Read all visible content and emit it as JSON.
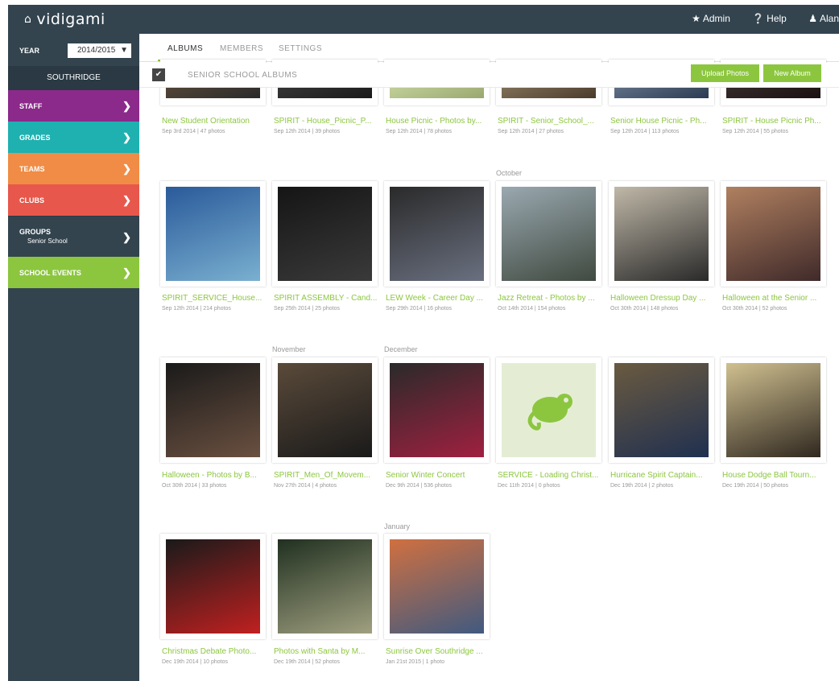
{
  "header": {
    "logo": "vidigami",
    "links": [
      {
        "icon": "star-icon",
        "label": "Admin"
      },
      {
        "icon": "help-icon",
        "label": "Help"
      },
      {
        "icon": "user-icon",
        "label": "Alan"
      }
    ]
  },
  "sidebar": {
    "year_label": "YEAR",
    "year_value": "2014/2015",
    "school": "SOUTHRIDGE",
    "items": [
      {
        "label": "STAFF",
        "color": "#8b2a8a"
      },
      {
        "label": "GRADES",
        "color": "#1eb1b0"
      },
      {
        "label": "TEAMS",
        "color": "#f08c45"
      },
      {
        "label": "CLUBS",
        "color": "#e8574b"
      },
      {
        "label": "GROUPS",
        "sub": "Senior School",
        "color": "#33444f"
      },
      {
        "label": "SCHOOL EVENTS",
        "color": "#8cc63f"
      }
    ]
  },
  "tabs": [
    "ALBUMS",
    "MEMBERS",
    "SETTINGS"
  ],
  "album_bar": {
    "title": "SENIOR SCHOOL ALBUMS",
    "upload_label": "Upload Photos",
    "new_album_label": "New Album"
  },
  "months": [
    "October",
    "November",
    "December",
    "January"
  ],
  "albums": [
    {
      "title": "New Student Orientation",
      "meta": "Sep 3rd 2014 | 47 photos"
    },
    {
      "title": "SPIRIT - House_Picnic_P...",
      "meta": "Sep 12th 2014 | 39 photos"
    },
    {
      "title": "House Picnic - Photos by...",
      "meta": "Sep 12th 2014 | 78 photos"
    },
    {
      "title": "SPIRIT - Senior_School_...",
      "meta": "Sep 12th 2014 | 27 photos"
    },
    {
      "title": "Senior House Picnic - Ph...",
      "meta": "Sep 12th 2014 | 113 photos"
    },
    {
      "title": "SPIRIT - House Picnic Ph...",
      "meta": "Sep 12th 2014 | 55 photos"
    },
    {
      "title": "SPIRIT_SERVICE_House...",
      "meta": "Sep 12th 2014 | 214 photos"
    },
    {
      "title": "SPIRIT ASSEMBLY - Cand...",
      "meta": "Sep 25th 2014 | 25 photos"
    },
    {
      "title": "LEW Week - Career Day ...",
      "meta": "Sep 29th 2014 | 16 photos"
    },
    {
      "title": "Jazz Retreat - Photos by ...",
      "meta": "Oct 14th 2014 | 154 photos"
    },
    {
      "title": "Halloween Dressup Day ...",
      "meta": "Oct 30th 2014 | 148 photos"
    },
    {
      "title": "Halloween at the Senior ...",
      "meta": "Oct 30th 2014 | 52 photos"
    },
    {
      "title": "Halloween - Photos by B...",
      "meta": "Oct 30th 2014 | 33 photos"
    },
    {
      "title": "SPIRIT_Men_Of_Movem...",
      "meta": "Nov 27th 2014 | 4 photos"
    },
    {
      "title": "Senior Winter Concert",
      "meta": "Dec 9th 2014 | 536 photos"
    },
    {
      "title": "SERVICE - Loading Christ...",
      "meta": "Dec 11th 2014 | 0 photos"
    },
    {
      "title": "Hurricane Spirit Captain...",
      "meta": "Dec 19th 2014 | 2 photos"
    },
    {
      "title": "House Dodge Ball Tourn...",
      "meta": "Dec 19th 2014 | 50 photos"
    },
    {
      "title": "Christmas Debate Photo...",
      "meta": "Dec 19th 2014 | 10 photos"
    },
    {
      "title": "Photos with Santa by M...",
      "meta": "Dec 19th 2014 | 52 photos"
    },
    {
      "title": "Sunrise Over Southridge ...",
      "meta": "Jan 21st 2015 | 1 photo"
    }
  ],
  "colors": {
    "accent": "#8cc63f",
    "nav": "#33444f"
  }
}
